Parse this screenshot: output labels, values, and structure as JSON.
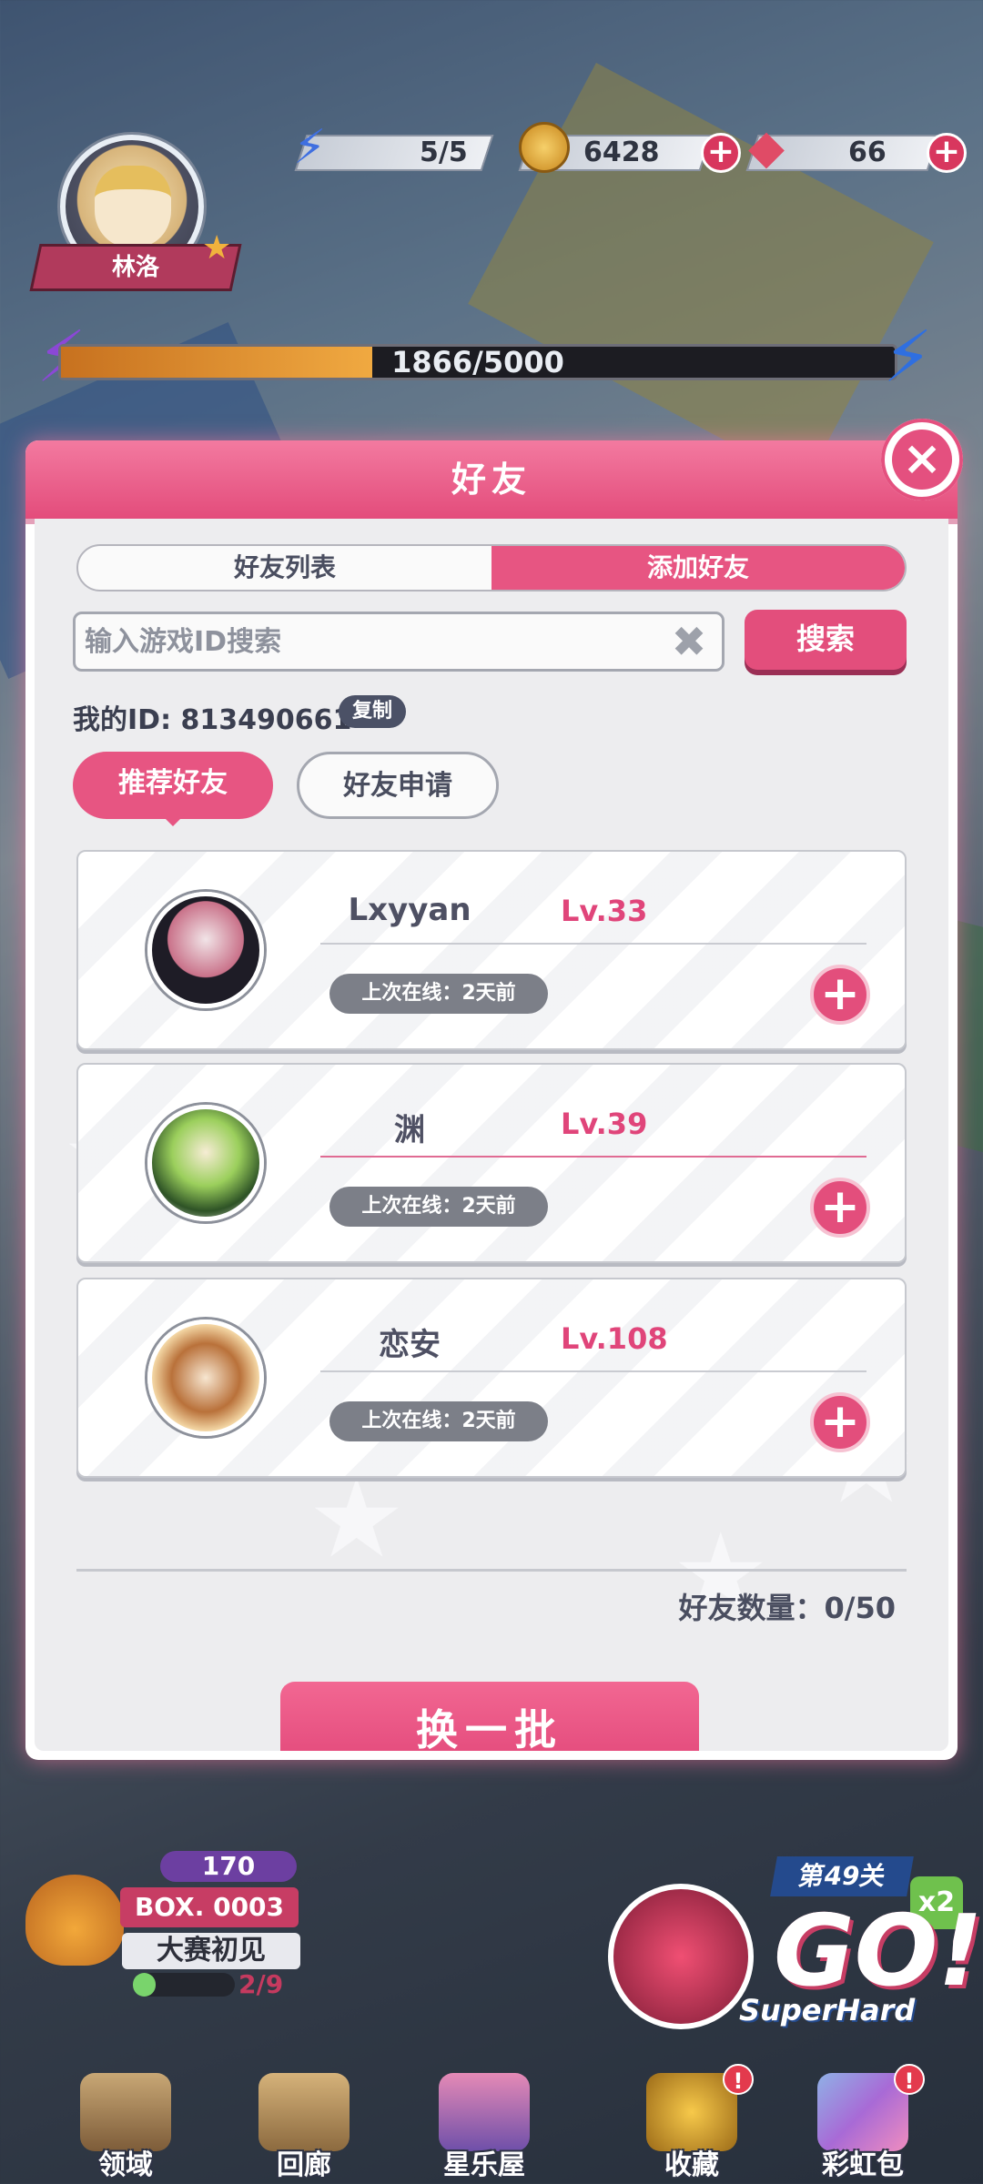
{
  "hud": {
    "player_name": "林洛",
    "energy": "5/5",
    "coins": "6428",
    "gems": "66",
    "exp_text": "1866/5000",
    "exp_progress": 0.3732
  },
  "dialog": {
    "title": "好友",
    "tabs": [
      "好友列表",
      "添加好友"
    ],
    "active_tab": "添加好友",
    "search_placeholder": "输入游戏ID搜索",
    "search_button": "搜索",
    "my_id_text": "我的ID: 813490661",
    "copy_button": "复制",
    "subtabs": [
      "推荐好友",
      "好友申请"
    ],
    "active_subtab": "推荐好友",
    "friends": [
      {
        "name": "Lxyyan",
        "level": "Lv.33",
        "last_online": "上次在线：2天前"
      },
      {
        "name": "渊",
        "level": "Lv.39",
        "last_online": "上次在线：2天前"
      },
      {
        "name": "恋安",
        "level": "Lv.108",
        "last_online": "上次在线：2天前"
      }
    ],
    "friend_count": "好友数量：0/50",
    "refresh_button": "换一批"
  },
  "event": {
    "gem_count": "170",
    "box_label": "BOX. 0003",
    "title": "大赛初见",
    "progress": "2/9",
    "progress_value": 0.222
  },
  "stage": {
    "level_label": "第49关",
    "multiplier": "x2",
    "go_text": "GO!",
    "difficulty": "SuperHard"
  },
  "nav": [
    {
      "label": "领域",
      "alert": false
    },
    {
      "label": "回廊",
      "alert": false
    },
    {
      "label": "星乐屋",
      "alert": false
    },
    {
      "label": "收藏",
      "alert": true
    },
    {
      "label": "彩虹包",
      "alert": true
    }
  ],
  "colors": {
    "accent_pink": "#e34e7c",
    "level_pink": "#e0457a",
    "online_gray": "#7c7f88"
  }
}
